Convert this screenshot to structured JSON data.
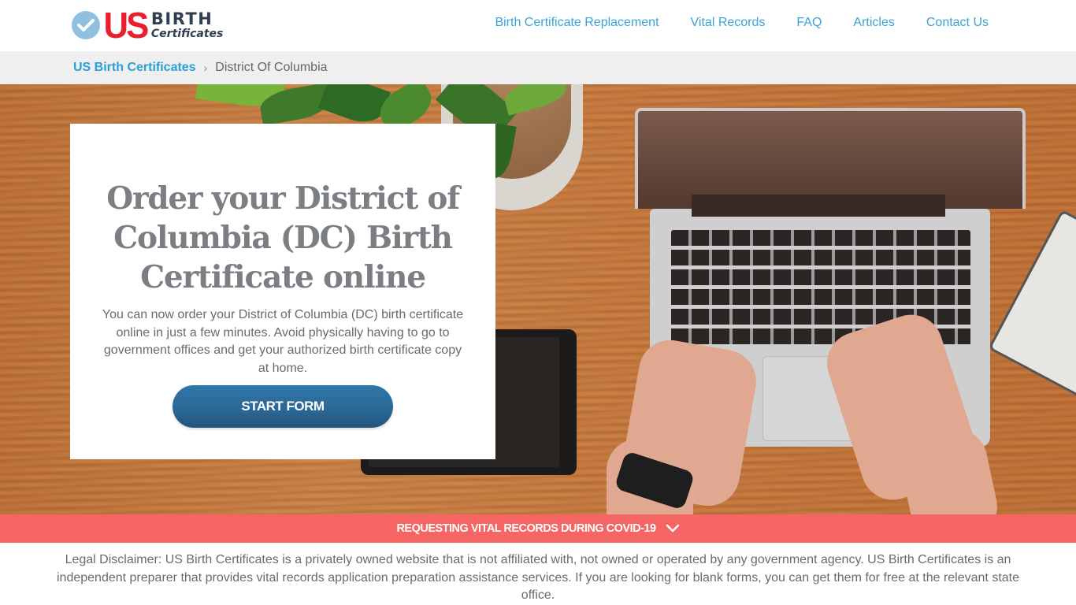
{
  "header": {
    "logo": {
      "icon": "check-circle-icon",
      "us": "US",
      "birth": "BIRTH",
      "certificates": "Certificates"
    },
    "nav": [
      {
        "label": "Birth Certificate Replacement"
      },
      {
        "label": "Vital Records"
      },
      {
        "label": "FAQ"
      },
      {
        "label": "Articles"
      },
      {
        "label": "Contact Us"
      }
    ]
  },
  "breadcrumb": {
    "home": "US Birth Certificates",
    "separator": "›",
    "current": "District Of Columbia"
  },
  "hero": {
    "title": "Order your District of Columbia (DC) Birth Certificate online",
    "description": "You can now order your District of Columbia (DC) birth certificate online in just a few minutes. Avoid physically having to go to government offices and get your authorized birth certificate copy at home.",
    "cta_label": "START FORM"
  },
  "covid_banner": {
    "label": "REQUESTING VITAL RECORDS DURING COVID-19",
    "icon": "chevron-down-icon"
  },
  "disclaimer": "Legal Disclaimer: US Birth Certificates is a privately owned website that is not affiliated with, not owned or operated by any government agency. US Birth Certificates is an independent preparer that provides vital records application preparation assistance services. If you are looking for blank forms, you can get them for free at the relevant state office.",
  "colors": {
    "nav_link": "#3aa3d6",
    "logo_red": "#e8202e",
    "logo_navy": "#2f3f50",
    "logo_check": "#8fc1de",
    "breadcrumb_bg": "#efefef",
    "cta_button": "#2a6694",
    "covid_banner": "#f46564",
    "body_text": "#6a6a6a"
  }
}
